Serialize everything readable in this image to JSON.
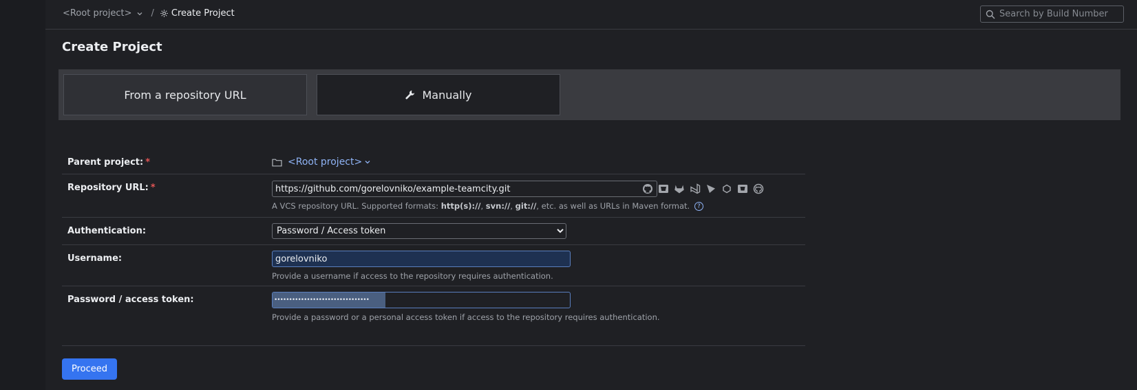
{
  "breadcrumb": {
    "root": "<Root project>",
    "separator": "/",
    "current": "Create Project"
  },
  "search": {
    "placeholder": "Search by Build Number"
  },
  "page": {
    "title": "Create Project"
  },
  "tabs": [
    {
      "label": "From a repository URL"
    },
    {
      "label": "Manually",
      "icon": "wrench-icon"
    }
  ],
  "form": {
    "parent_project": {
      "label": "Parent project:",
      "required_mark": "*",
      "value": "<Root project>"
    },
    "repository_url": {
      "label": "Repository URL:",
      "required_mark": "*",
      "value": "https://github.com/gorelovniko/example-teamcity.git",
      "help_prefix": "A VCS repository URL. Supported formats: ",
      "fmt1": "http(s)://",
      "sep1": ", ",
      "fmt2": "svn://",
      "sep2": ", ",
      "fmt3": "git://",
      "help_suffix": ", etc. as well as URLs in Maven format.",
      "help_icon": "?",
      "vcs_icons": [
        "github-icon",
        "bitbucket-icon",
        "gitlab-icon",
        "azure-devops-icon",
        "jetbrains-space-icon",
        "perforce-icon",
        "bitbucket-server-icon",
        "github-enterprise-icon"
      ]
    },
    "authentication": {
      "label": "Authentication:",
      "value": "Password / Access token"
    },
    "username": {
      "label": "Username:",
      "value": "gorelovniko",
      "help": "Provide a username if access to the repository requires authentication."
    },
    "password": {
      "label": "Password / access token:",
      "mask": "••••••••••••••••••••••••••••••••",
      "help": "Provide a password or a personal access token if access to the repository requires authentication."
    }
  },
  "actions": {
    "proceed_label": "Proceed"
  },
  "colors": {
    "accent": "#3574f0",
    "background": "#1f2024",
    "link": "#8fb3f5"
  }
}
